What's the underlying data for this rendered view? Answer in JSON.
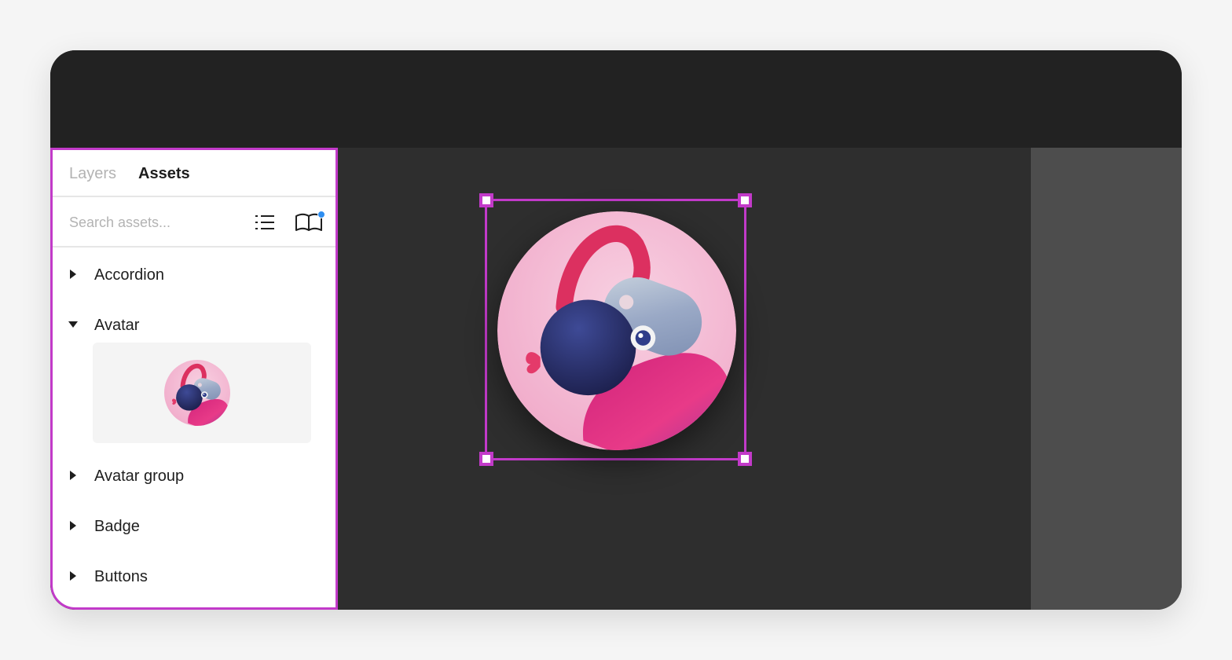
{
  "panel": {
    "tabs": [
      {
        "label": "Layers",
        "active": false
      },
      {
        "label": "Assets",
        "active": true
      }
    ]
  },
  "search": {
    "placeholder": "Search assets...",
    "value": ""
  },
  "toolbar_icons": {
    "list_view": "list-view-icon",
    "library": "book-icon",
    "library_notification": true
  },
  "assets": [
    {
      "label": "Accordion",
      "expanded": false
    },
    {
      "label": "Avatar",
      "expanded": true
    },
    {
      "label": "Avatar group",
      "expanded": false
    },
    {
      "label": "Badge",
      "expanded": false
    },
    {
      "label": "Buttons",
      "expanded": false
    }
  ],
  "colors": {
    "selection": "#c23ac9",
    "notification": "#2e8ef0",
    "canvas": "#2e2e2e",
    "toolbar": "#222222",
    "right_panel": "#4d4d4d"
  }
}
